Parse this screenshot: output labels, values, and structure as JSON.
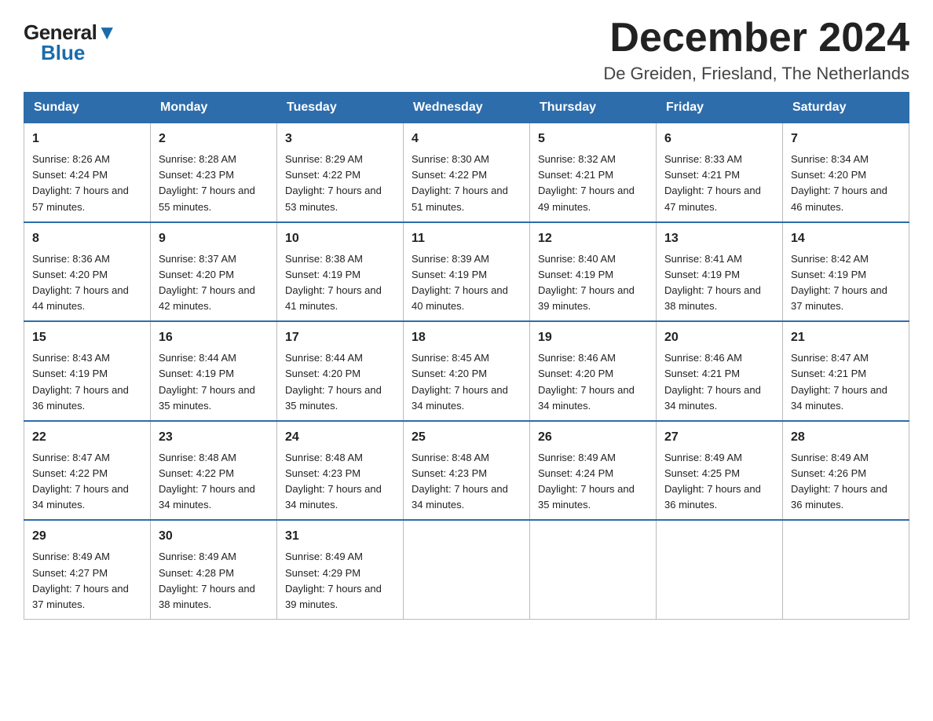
{
  "logo": {
    "general": "General",
    "blue": "Blue",
    "triangle": true
  },
  "header": {
    "month_title": "December 2024",
    "location": "De Greiden, Friesland, The Netherlands"
  },
  "days_of_week": [
    "Sunday",
    "Monday",
    "Tuesday",
    "Wednesday",
    "Thursday",
    "Friday",
    "Saturday"
  ],
  "weeks": [
    [
      {
        "day": "1",
        "sunrise": "8:26 AM",
        "sunset": "4:24 PM",
        "daylight": "7 hours and 57 minutes."
      },
      {
        "day": "2",
        "sunrise": "8:28 AM",
        "sunset": "4:23 PM",
        "daylight": "7 hours and 55 minutes."
      },
      {
        "day": "3",
        "sunrise": "8:29 AM",
        "sunset": "4:22 PM",
        "daylight": "7 hours and 53 minutes."
      },
      {
        "day": "4",
        "sunrise": "8:30 AM",
        "sunset": "4:22 PM",
        "daylight": "7 hours and 51 minutes."
      },
      {
        "day": "5",
        "sunrise": "8:32 AM",
        "sunset": "4:21 PM",
        "daylight": "7 hours and 49 minutes."
      },
      {
        "day": "6",
        "sunrise": "8:33 AM",
        "sunset": "4:21 PM",
        "daylight": "7 hours and 47 minutes."
      },
      {
        "day": "7",
        "sunrise": "8:34 AM",
        "sunset": "4:20 PM",
        "daylight": "7 hours and 46 minutes."
      }
    ],
    [
      {
        "day": "8",
        "sunrise": "8:36 AM",
        "sunset": "4:20 PM",
        "daylight": "7 hours and 44 minutes."
      },
      {
        "day": "9",
        "sunrise": "8:37 AM",
        "sunset": "4:20 PM",
        "daylight": "7 hours and 42 minutes."
      },
      {
        "day": "10",
        "sunrise": "8:38 AM",
        "sunset": "4:19 PM",
        "daylight": "7 hours and 41 minutes."
      },
      {
        "day": "11",
        "sunrise": "8:39 AM",
        "sunset": "4:19 PM",
        "daylight": "7 hours and 40 minutes."
      },
      {
        "day": "12",
        "sunrise": "8:40 AM",
        "sunset": "4:19 PM",
        "daylight": "7 hours and 39 minutes."
      },
      {
        "day": "13",
        "sunrise": "8:41 AM",
        "sunset": "4:19 PM",
        "daylight": "7 hours and 38 minutes."
      },
      {
        "day": "14",
        "sunrise": "8:42 AM",
        "sunset": "4:19 PM",
        "daylight": "7 hours and 37 minutes."
      }
    ],
    [
      {
        "day": "15",
        "sunrise": "8:43 AM",
        "sunset": "4:19 PM",
        "daylight": "7 hours and 36 minutes."
      },
      {
        "day": "16",
        "sunrise": "8:44 AM",
        "sunset": "4:19 PM",
        "daylight": "7 hours and 35 minutes."
      },
      {
        "day": "17",
        "sunrise": "8:44 AM",
        "sunset": "4:20 PM",
        "daylight": "7 hours and 35 minutes."
      },
      {
        "day": "18",
        "sunrise": "8:45 AM",
        "sunset": "4:20 PM",
        "daylight": "7 hours and 34 minutes."
      },
      {
        "day": "19",
        "sunrise": "8:46 AM",
        "sunset": "4:20 PM",
        "daylight": "7 hours and 34 minutes."
      },
      {
        "day": "20",
        "sunrise": "8:46 AM",
        "sunset": "4:21 PM",
        "daylight": "7 hours and 34 minutes."
      },
      {
        "day": "21",
        "sunrise": "8:47 AM",
        "sunset": "4:21 PM",
        "daylight": "7 hours and 34 minutes."
      }
    ],
    [
      {
        "day": "22",
        "sunrise": "8:47 AM",
        "sunset": "4:22 PM",
        "daylight": "7 hours and 34 minutes."
      },
      {
        "day": "23",
        "sunrise": "8:48 AM",
        "sunset": "4:22 PM",
        "daylight": "7 hours and 34 minutes."
      },
      {
        "day": "24",
        "sunrise": "8:48 AM",
        "sunset": "4:23 PM",
        "daylight": "7 hours and 34 minutes."
      },
      {
        "day": "25",
        "sunrise": "8:48 AM",
        "sunset": "4:23 PM",
        "daylight": "7 hours and 34 minutes."
      },
      {
        "day": "26",
        "sunrise": "8:49 AM",
        "sunset": "4:24 PM",
        "daylight": "7 hours and 35 minutes."
      },
      {
        "day": "27",
        "sunrise": "8:49 AM",
        "sunset": "4:25 PM",
        "daylight": "7 hours and 36 minutes."
      },
      {
        "day": "28",
        "sunrise": "8:49 AM",
        "sunset": "4:26 PM",
        "daylight": "7 hours and 36 minutes."
      }
    ],
    [
      {
        "day": "29",
        "sunrise": "8:49 AM",
        "sunset": "4:27 PM",
        "daylight": "7 hours and 37 minutes."
      },
      {
        "day": "30",
        "sunrise": "8:49 AM",
        "sunset": "4:28 PM",
        "daylight": "7 hours and 38 minutes."
      },
      {
        "day": "31",
        "sunrise": "8:49 AM",
        "sunset": "4:29 PM",
        "daylight": "7 hours and 39 minutes."
      },
      null,
      null,
      null,
      null
    ]
  ]
}
